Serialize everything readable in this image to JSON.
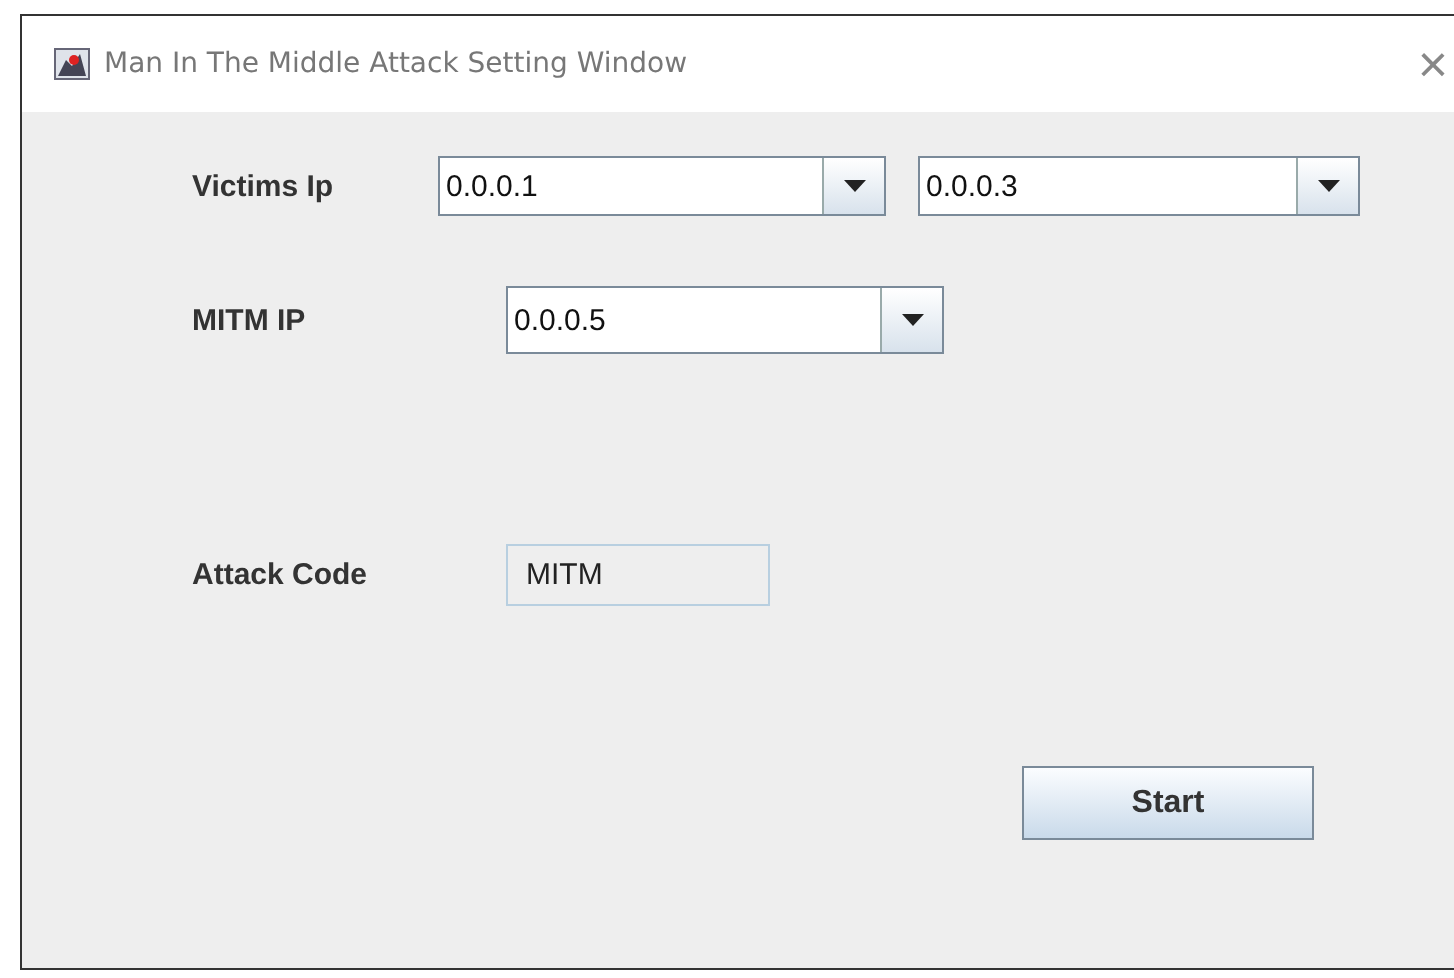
{
  "window": {
    "title": "Man In The Middle Attack Setting Window",
    "close": "×"
  },
  "victims": {
    "label": "Victims Ip",
    "combos": [
      {
        "value": "0.0.0.1"
      },
      {
        "value": "0.0.0.3"
      }
    ]
  },
  "mitm": {
    "label": "MITM IP",
    "value": "0.0.0.5"
  },
  "attack_code": {
    "label": "Attack Code",
    "value": "MITM",
    "disabled": true
  },
  "buttons": [
    "Start"
  ]
}
